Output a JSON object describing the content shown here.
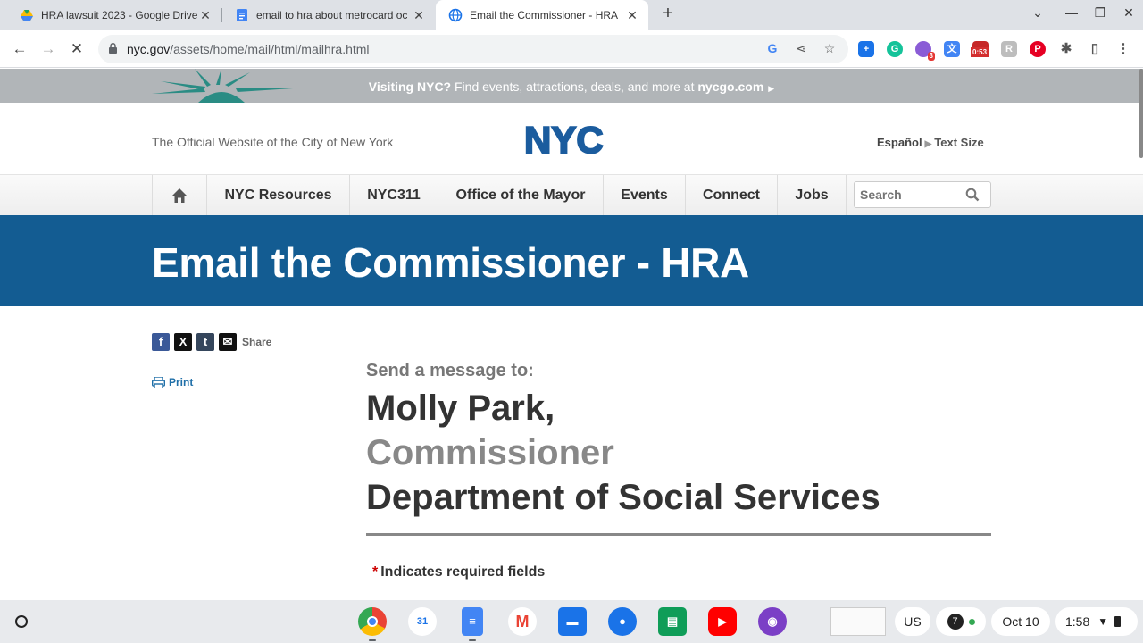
{
  "browser": {
    "tabs": [
      {
        "title": "HRA lawsuit 2023 - Google Drive",
        "icon": "google-drive-icon"
      },
      {
        "title": "email to hra about metrocard oc",
        "icon": "google-docs-icon"
      },
      {
        "title": "Email the Commissioner - HRA",
        "icon": "globe-icon",
        "active": true
      }
    ],
    "url_host": "nyc.gov",
    "url_path": "/assets/home/mail/html/mailhra.html",
    "extension_badges": {
      "grammarly_count": "3",
      "timer": "0:53"
    }
  },
  "site": {
    "visit_bold": "Visiting NYC?",
    "visit_text": " Find events, attractions, deals, and more at ",
    "visit_link": "nycgo.com",
    "official": "The Official Website of the City of New York",
    "logo_text": "NYC",
    "lang": "Español",
    "text_size": "Text Size",
    "nav": [
      "NYC Resources",
      "NYC311",
      "Office of the Mayor",
      "Events",
      "Connect",
      "Jobs"
    ],
    "search_placeholder": "Search",
    "page_title": "Email the Commissioner - HRA",
    "share_label": "Share",
    "print_label": "Print",
    "send_to": "Send a message to:",
    "recipient_name": "Molly Park,",
    "recipient_role": "Commissioner",
    "recipient_dept": "Department of Social Services",
    "required_star": "*",
    "required_note": "Indicates required fields"
  },
  "shelf": {
    "apps": [
      "chrome-icon",
      "calendar-icon",
      "docs-icon",
      "gmail-icon",
      "files-icon",
      "messages-icon",
      "classroom-icon",
      "youtube-icon",
      "podcast-icon"
    ],
    "calendar_day": "31",
    "input_method": "US",
    "notifications": "7",
    "date": "Oct 10",
    "time": "1:58"
  },
  "colors": {
    "banner": "#135c92",
    "tabstrip": "#dee1e6",
    "visit_bar": "#b1b5b8",
    "nyc_logo": "#1b5c9e"
  }
}
